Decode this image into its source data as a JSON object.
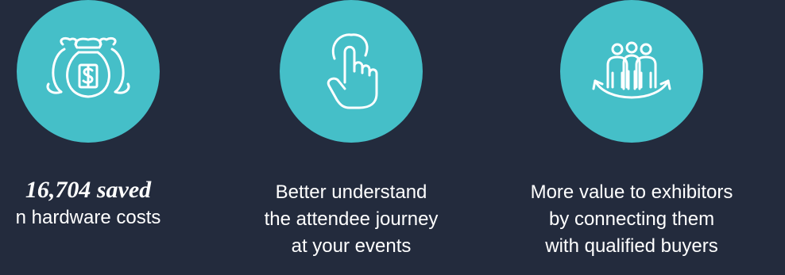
{
  "colors": {
    "background": "#232b3d",
    "circle": "#45bfc8",
    "icon_stroke": "#ffffff",
    "text": "#ffffff"
  },
  "features": [
    {
      "icon": "money-bags-icon",
      "stat": "16,704 saved",
      "lines": [
        "n hardware costs"
      ]
    },
    {
      "icon": "hand-pointer-icon",
      "lines": [
        "Better understand",
        "the attendee journey",
        "at your events"
      ]
    },
    {
      "icon": "people-connection-icon",
      "lines": [
        "More value to exhibitors",
        "by connecting them",
        "with qualified buyers"
      ]
    }
  ]
}
